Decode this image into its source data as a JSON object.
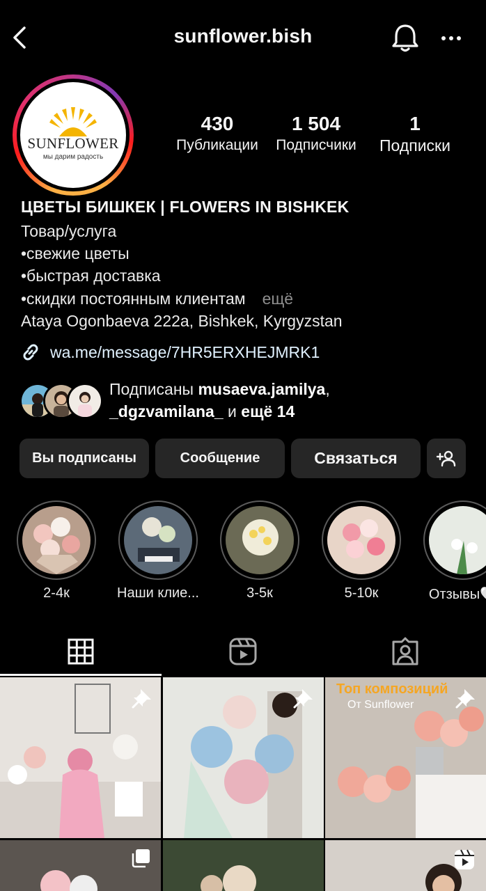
{
  "header": {
    "username": "sunflower.bish",
    "back_icon": "chevron-left-icon",
    "bell_icon": "bell-icon",
    "more_icon": "more-horizontal-icon"
  },
  "profile": {
    "avatar": {
      "logo_word": "SUNFLOWER",
      "logo_tagline": "мы дарим радость"
    },
    "stats": [
      {
        "value": "430",
        "label": "Публикации"
      },
      {
        "value": "1 504",
        "label": "Подписчики"
      },
      {
        "value": "1",
        "label": "Подписки"
      }
    ],
    "name": "ЦВЕТЫ БИШКЕК | FLOWERS IN BISHKEK",
    "category": "Товар/услуга",
    "bio_lines": [
      "•свежие цветы",
      "•быстрая доставка",
      "•скидки постоянным клиентам"
    ],
    "more_label": "ещё",
    "address": "Ataya Ogonbaeva 222a, Bishkek, Kyrgyzstan",
    "link": "wa.me/message/7HR5ERXHEJMRK1"
  },
  "followed_by": {
    "prefix": "Подписаны ",
    "user1": "musaeva.jamilya",
    "separator": ",",
    "user2": "_dgzvamilana_",
    "middle": " и ",
    "more": "ещё 14"
  },
  "actions": {
    "following": "Вы подписаны",
    "message": "Сообщение",
    "contact": "Связаться",
    "add_user_icon": "add-user-icon"
  },
  "highlights": [
    {
      "label": "2-4к"
    },
    {
      "label": "Наши клие..."
    },
    {
      "label": "3-5к"
    },
    {
      "label": "5-10к"
    },
    {
      "label": "Отзывы🤍"
    }
  ],
  "tabs": [
    {
      "name": "grid",
      "icon": "grid-icon",
      "active": true
    },
    {
      "name": "reels",
      "icon": "reels-icon",
      "active": false
    },
    {
      "name": "tagged",
      "icon": "tagged-user-icon",
      "active": false
    }
  ],
  "posts": {
    "tile3_title": "Топ композиций",
    "tile3_sub": "От Sunflower"
  },
  "colors": {
    "background": "#000000",
    "button_bg": "#262626",
    "muted": "#8e8e8e",
    "link": "#e0f1ff",
    "overlay_text": "#f5a623"
  }
}
